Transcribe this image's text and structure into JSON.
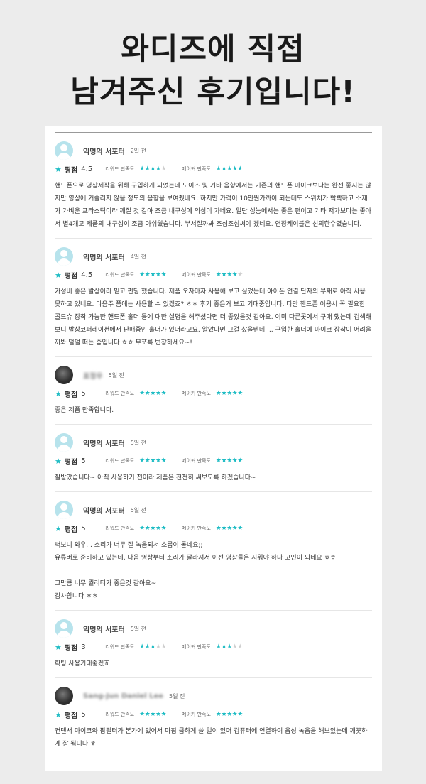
{
  "headline": {
    "line1": "와디즈에 직접",
    "line2": "남겨주신 후기입니다!"
  },
  "labels": {
    "score": "평점",
    "rewards": "리워드 만족도",
    "maker": "메이커 만족도"
  },
  "colors": {
    "accent": "#1ebcc4",
    "star_off": "#cfcfcf"
  },
  "reviews": [
    {
      "name": "익명의 서포터",
      "date": "2일 전",
      "score": "4.5",
      "reward_stars": 4,
      "maker_stars": 5,
      "text": [
        "핸드폰으로 영상제작을 위해 구입하게 되었는데 노이즈 및 기타 음향에서는 기존의 핸드폰 마이크보다는 완전 좋지는 않지만 영상에 거슬리지 않을 정도의 음향을 보여줬네요. 하지만 가격이 10만원가까이 되는데도 스위치가 빡빡하고 소재가 가벼운 프라스틱이라 깨질 것 같아 조금 내구성에 의심이 가네요. 일단 성능에서는 좋은 편이고 기타 저가보다는 좋아서 별4개고 제품의 내구성이 조금 아쉬웠습니다. 부서질까봐 조심조심써야 겠네요. 연장케이블은 신의한수였습니다."
      ]
    },
    {
      "name": "익명의 서포터",
      "date": "4일 전",
      "score": "4.5",
      "reward_stars": 5,
      "maker_stars": 4,
      "text": [
        "가성비 좋은 발상이라 믿고 펀딩 했습니다. 제품 오자마자 사용해 보고 싶었는데 아이폰 연결 단자의 부재로 아직 사용 못하고 있네요. 다음주 쯤에는 사용할 수 있겠죠? ㅎㅎ 후기 좋은거 보고 기대중입니다. 다만 핸드폰 이용시 꼭 필요한 콜드슈 장착 가능한 핸드폰 홀더 등에 대한 설명을 해주셨다면 더 좋았을것 같아요. 이미 다른곳에서 구매 했는데 검색해보니 발상코퍼레이션에서 판매중인 홀더가 있더라고요. 알았다면 그걸 샀을텐데 ,,, 구입한 홀더에 마이크 장착이 어려울까봐 덜덜 떠는 중입니다 ㅎㅎ 무쪼록 번창하세요~!"
      ]
    },
    {
      "name": "표정우",
      "date": "5일 전",
      "score": "5",
      "reward_stars": 5,
      "maker_stars": 5,
      "photo": true,
      "blurred": true,
      "text": [
        "좋은 제품 만족합니다."
      ]
    },
    {
      "name": "익명의 서포터",
      "date": "5일 전",
      "score": "5",
      "reward_stars": 5,
      "maker_stars": 5,
      "text": [
        "잘받았습니다~ 아직 사용하기 전이라 제품은 천천히 써보도록 하겠습니다~"
      ]
    },
    {
      "name": "익명의 서포터",
      "date": "5일 전",
      "score": "5",
      "reward_stars": 5,
      "maker_stars": 5,
      "text": [
        "써보니 와우... 소리가 너무 잘 녹음되서 소름이 돋네요;;\n유튜버로 준비하고 있는데, 다음 영상부터 소리가 달라져서 이전 영상들은 지워야 하나 고민이 되네요 ㅎㅎ\n\n그만큼 너무 퀄리티가 좋은것 같아요~\n감사합니다 ㅎㅎ"
      ]
    },
    {
      "name": "익명의 서포터",
      "date": "5일 전",
      "score": "3",
      "reward_stars": 3,
      "maker_stars": 3,
      "text": [
        "확팅 사용기대좋겠죠"
      ]
    },
    {
      "name": "Sang-Jun Daniel Lee",
      "date": "5일 전",
      "score": "5",
      "reward_stars": 5,
      "maker_stars": 5,
      "photo": true,
      "blurred": true,
      "text": [
        "컨덴서 마이크와 팝필터가 본가에 있어서 마침 급하게 쓸 일이 있어 컴퓨터에 연결하여 음성 녹음을 해보았는데 깨끗하게 잘 됩니다 ㅎ"
      ]
    }
  ]
}
